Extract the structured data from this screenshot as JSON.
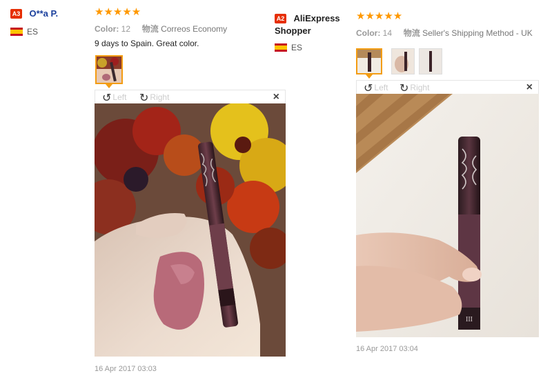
{
  "reviews": [
    {
      "badge": "A3",
      "badge_color": "#e62e04",
      "username": "O**a P.",
      "country": "ES",
      "stars": "★★★★★",
      "color_label": "Color:",
      "color_value": "12",
      "shipping_label": "物流",
      "shipping_value": "Correos Economy",
      "feedback": "9 days to Spain. Great color.",
      "viewer": {
        "left_label": "Left",
        "right_label": "Right",
        "close": "×"
      },
      "date": "16 Apr 2017 03:03"
    },
    {
      "badge": "A2",
      "badge_color": "#e62e04",
      "username": "AliExpress Shopper",
      "country": "ES",
      "stars": "★★★★★",
      "color_label": "Color:",
      "color_value": "14",
      "shipping_label": "物流",
      "shipping_value": "Seller's Shipping Method - UK",
      "viewer": {
        "left_label": "Left",
        "right_label": "Right",
        "close": "×"
      },
      "date": "16 Apr 2017 03:04"
    }
  ],
  "icons": {
    "rotate_left": "↺",
    "rotate_right": "↻",
    "star": "star-icon",
    "flag": "spain-flag-icon"
  },
  "colors": {
    "accent": "#ff9800",
    "username": "#1a3f9c",
    "thumb_selected": "#f39c12"
  }
}
